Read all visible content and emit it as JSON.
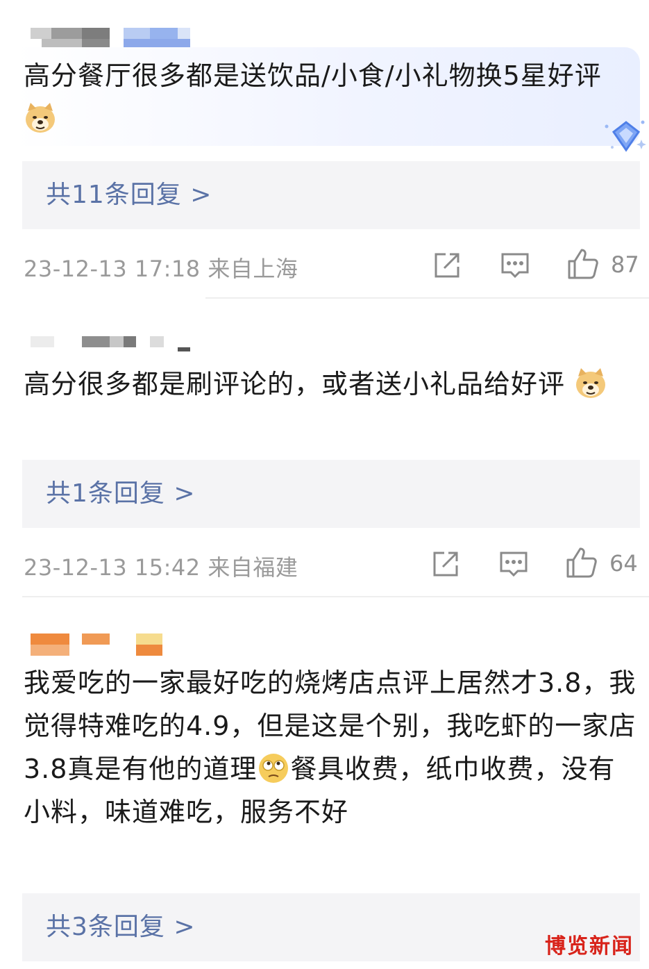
{
  "comments": [
    {
      "text_before_emoji": "高分餐厅很多都是送饮品/小食/小礼物换5星好评",
      "emoji_name": "doge-emoji",
      "replies_label": "共11条回复 >",
      "meta_text": "23-12-13 17:18  来自上海",
      "like_count": "87"
    },
    {
      "text_before_emoji": "高分很多都是刷评论的，或者送小礼品给好评",
      "emoji_name": "doge-emoji",
      "replies_label": "共1条回复 >",
      "meta_text": "23-12-13 15:42  来自福建",
      "like_count": "64"
    },
    {
      "text_part1": "我爱吃的一家最好吃的烧烤店点评上居然才3.8，我觉得特难吃的4.9，但是这是个别，我吃虾的一家店3.8真是有他的道理",
      "emoji_name": "speechless-emoji",
      "text_part2": "餐具收费，纸巾收费，没有小料，味道难吃，服务不好",
      "replies_label": "共3条回复 >"
    }
  ],
  "watermark": "博览新闻",
  "colors": {
    "reply_link": "#5a72a6",
    "meta_gray": "#9a9a9a",
    "reply_bg": "#f4f4f6",
    "watermark_red": "#d8231a"
  }
}
